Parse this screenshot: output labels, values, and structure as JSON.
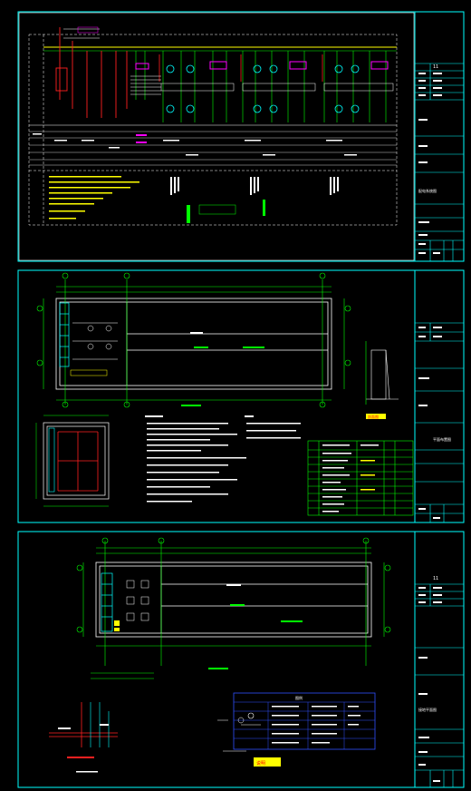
{
  "sheets": [
    {
      "id": "sheet-1",
      "title_block": {
        "sheet_no": "11",
        "drawing_name": "配电系统图"
      }
    },
    {
      "id": "sheet-2",
      "title_block": {
        "sheet_no": "",
        "drawing_name": "平面布置图"
      },
      "section_label": "剖面图"
    },
    {
      "id": "sheet-3",
      "title_block": {
        "sheet_no": "11",
        "drawing_name": "接地平面图"
      },
      "legend_title": "图例",
      "highlight_label": "说明"
    }
  ],
  "colors": {
    "frame": "#00ffff",
    "line_green": "#00ff00",
    "line_red": "#ff2020",
    "line_yellow": "#ffff00",
    "line_magenta": "#ff00ff",
    "line_white": "#ffffff",
    "line_blue": "#3050ff"
  }
}
